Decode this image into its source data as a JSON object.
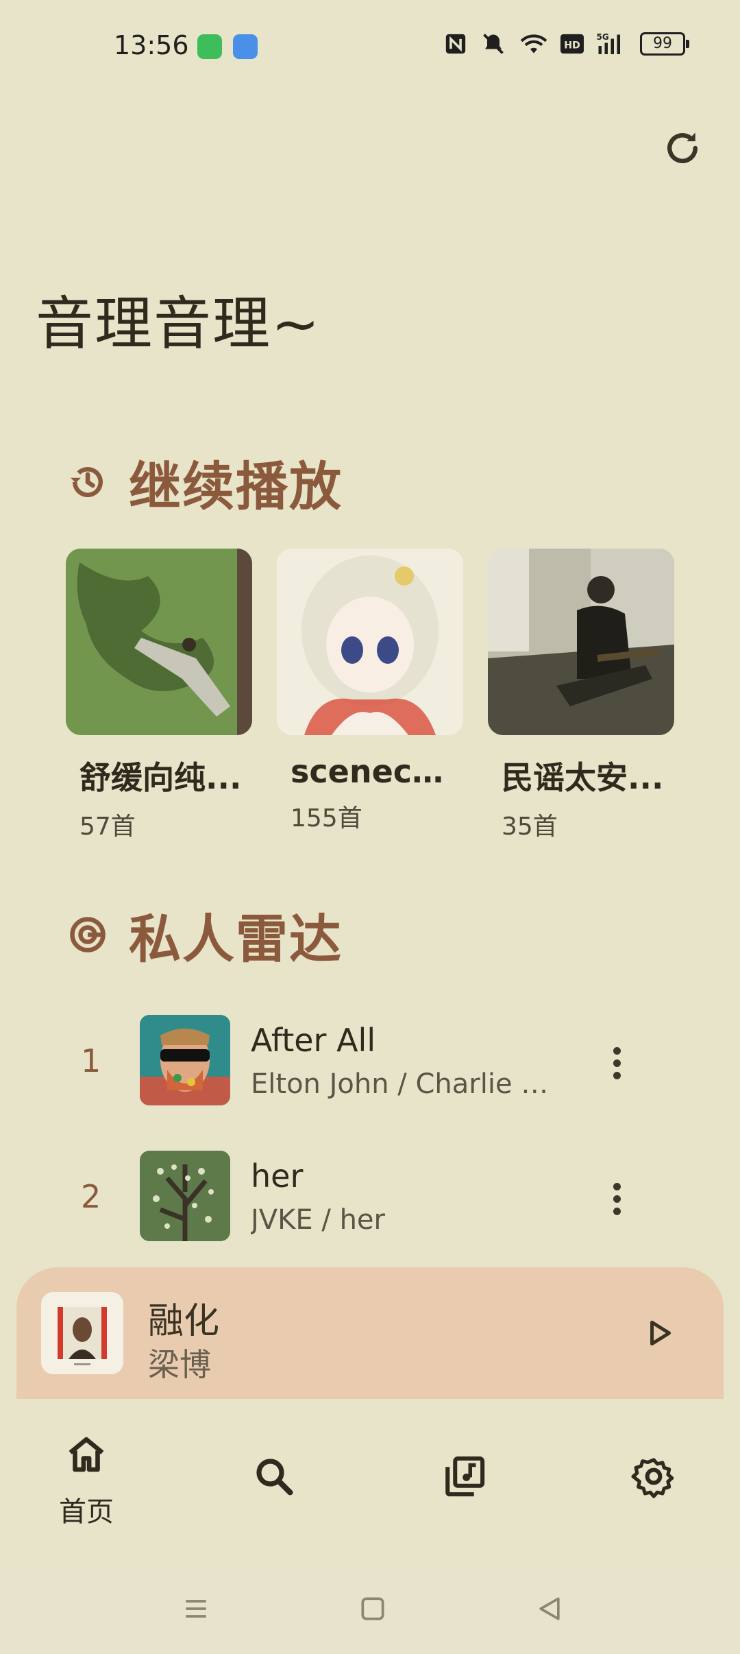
{
  "status_bar": {
    "time": "13:56",
    "battery": "99",
    "icons": [
      "messages-icon",
      "weather-icon",
      "nfc-icon",
      "mute-icon",
      "wifi-icon",
      "hd-icon",
      "signal-5g-icon"
    ]
  },
  "header": {
    "title": "音理音理~",
    "refresh_icon": "refresh-icon"
  },
  "continue_section": {
    "title": "继续播放",
    "icon": "history-icon",
    "cards": [
      {
        "title": "舒缓向纯音乐",
        "display_title": "舒缓向纯...",
        "count": "57首"
      },
      {
        "title": "sceneco...",
        "display_title": "sceneco...",
        "count": "155首"
      },
      {
        "title": "民谣太安...",
        "display_title": "民谣太安...",
        "count": "35首"
      }
    ]
  },
  "radar_section": {
    "title": "私人雷达",
    "icon": "radar-icon",
    "tracks": [
      {
        "rank": "1",
        "title": "After All",
        "subtitle": "Elton John / Charlie P..."
      },
      {
        "rank": "2",
        "title": "her",
        "subtitle": "JVKE / her"
      }
    ]
  },
  "mini_player": {
    "title": "融化",
    "artist": "梁博"
  },
  "bottom_nav": {
    "items": [
      {
        "label": "首页",
        "icon": "home-icon",
        "active": true
      },
      {
        "label": "",
        "icon": "search-icon",
        "active": false
      },
      {
        "label": "",
        "icon": "library-icon",
        "active": false
      },
      {
        "label": "",
        "icon": "settings-icon",
        "active": false
      }
    ]
  },
  "colors": {
    "background": "#E8E4C9",
    "accent": "#8B5A3C",
    "mini_player_bg": "#E9CCB0"
  }
}
